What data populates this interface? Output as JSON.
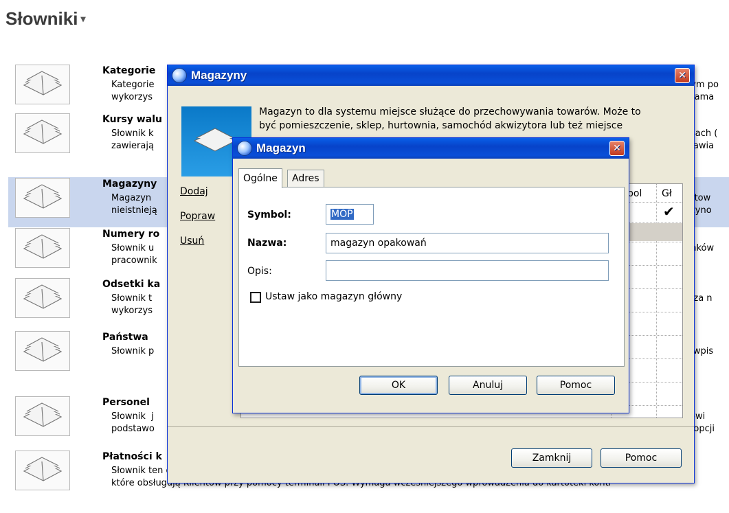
{
  "page": {
    "title": "Słowniki"
  },
  "dictionaries": [
    {
      "title": "Kategorie",
      "desc": "Kategorie\nwykorzys",
      "tail": "nym po\ngrama"
    },
    {
      "title": "Kursy walu",
      "desc": "Słownik k\nzawierają",
      "tail": "esach (\nstawia"
    },
    {
      "title": "Magazyny",
      "desc": "Magazyn\nnieistnieją",
      "tail": "urtow\nazyno"
    },
    {
      "title": "Numery ro",
      "desc": "Słownik u\npracownik",
      "tail": "unków"
    },
    {
      "title": "Odsetki ka",
      "desc": "Słownik t\nwykorzys",
      "tail": "n za n"
    },
    {
      "title": "Państwa",
      "desc": "Słownik p",
      "tail": "y wpis"
    },
    {
      "title": "Personel",
      "desc": "Słownik  j\npodstawo",
      "tail": "kowi\nn opcji"
    },
    {
      "title": "Płatności k",
      "desc": "Słownik ten obejmuje płatności kartami kredytowymi przy wystawianiu dokumentów sprzedaży. Jest przeznaczony\nktóre obsługują Klientów przy pomocy terminali POS. Wymaga wcześniejszego wprowadzenia do kartoteki kontr",
      "tail": ""
    }
  ],
  "magazyny_window": {
    "title": "Magazyny",
    "description": "Magazyn to dla systemu miejsce służące do przechowywania towarów. Może to\nbyć pomieszczenie, sklep, hurtownia, samochód akwizytora lub też miejsce",
    "links": {
      "add": "Dodaj",
      "edit": "Popraw",
      "delete": "Usuń"
    },
    "columns": {
      "symbol": "bol",
      "main": "Gł"
    },
    "buttons": {
      "close": "Zamknij",
      "help": "Pomoc"
    }
  },
  "magazyn_dialog": {
    "title": "Magazyn",
    "tabs": {
      "general": "Ogólne",
      "address": "Adres"
    },
    "fields": {
      "symbol_label": "Symbol:",
      "symbol_value": "MOP",
      "name_label": "Nazwa:",
      "name_value": "magazyn opakowań",
      "desc_label": "Opis:",
      "desc_value": ""
    },
    "checkbox_label": "Ustaw jako magazyn główny",
    "buttons": {
      "ok": "OK",
      "cancel": "Anuluj",
      "help": "Pomoc"
    }
  }
}
